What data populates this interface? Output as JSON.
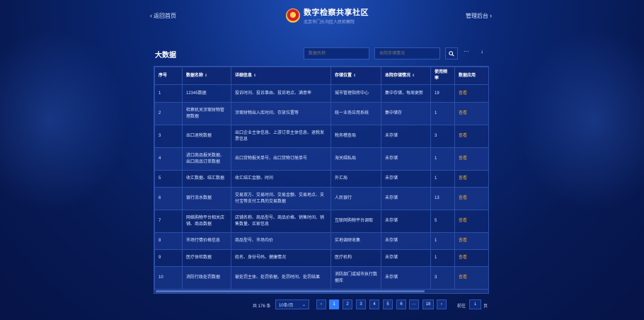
{
  "header": {
    "back_label": "返回首页",
    "title": "数字检察共享社区",
    "subtitle": "北京市门头沟区人民检察院",
    "admin_label": "管理后台"
  },
  "page_title": "大数据",
  "search": {
    "name_placeholder": "数据名称",
    "status_placeholder": "本院存储情况"
  },
  "toolbar": {
    "more_label": "···",
    "download_label": "↓"
  },
  "table": {
    "columns": [
      "序号",
      "数据名称",
      "详细信息",
      "存储位置",
      "本院存储情况",
      "使用频率",
      "数据应用"
    ],
    "rows": [
      {
        "no": "1",
        "name": "12345数据",
        "detail": "投诉时间、投诉事由、投诉地点、满意率",
        "location": "城市管理指挥中心",
        "status": "集中存储，每周更新",
        "freq": "19",
        "action": "查看"
      },
      {
        "no": "2",
        "name": "检察机关涉案财物管理数据",
        "detail": "涉案财物出入库时间、存放位置等",
        "location": "统一业务应用系统",
        "status": "集中储存",
        "freq": "1",
        "action": "查看"
      },
      {
        "no": "3",
        "name": "出口退税数据",
        "detail": "出口企业主体信息、上游订单主体信息、退税发票信息",
        "location": "税务稽查局",
        "status": "未存储",
        "freq": "3",
        "action": "查看"
      },
      {
        "no": "4",
        "name": "进口商品报关数据、出口商品订单数据",
        "detail": "出口货物报关单号、出口货物订舱单号",
        "location": "海关缉私局",
        "status": "未存储",
        "freq": "1",
        "action": "查看"
      },
      {
        "no": "5",
        "name": "收汇数据、结汇数据",
        "detail": "收汇结汇金额、时间",
        "location": "外汇局",
        "status": "未存储",
        "freq": "1",
        "action": "查看"
      },
      {
        "no": "6",
        "name": "银行流水数据",
        "detail": "交易双方、交易时间、交易金额、交易地点、支付宝等支付工具的交易数据",
        "location": "人民银行",
        "status": "未存储",
        "freq": "13",
        "action": "查看"
      },
      {
        "no": "7",
        "name": "网络购物平台相关店铺、商品数据",
        "detail": "店铺名称、商品型号、商品价格、销售时间、销售数量、买家信息",
        "location": "互联网购物平台调取",
        "status": "未存储",
        "freq": "5",
        "action": "查看"
      },
      {
        "no": "8",
        "name": "市场行情价格信息",
        "detail": "商品型号、市场均价",
        "location": "实地调研收集",
        "status": "未存储",
        "freq": "1",
        "action": "查看"
      },
      {
        "no": "9",
        "name": "医疗体检数据",
        "detail": "姓名、身份号码、健康情况",
        "location": "医疗机构",
        "status": "未存储",
        "freq": "1",
        "action": "查看"
      },
      {
        "no": "10",
        "name": "消防行政处罚数据",
        "detail": "被处罚主体、处罚依据、处罚时间、处罚结果",
        "location": "消防部门或城市执行数据库",
        "status": "未存储",
        "freq": "3",
        "action": "查看"
      }
    ]
  },
  "pagination": {
    "total_label": "共 176 条",
    "page_size_label": "10条/页",
    "prev": "‹",
    "pages": [
      "1",
      "2",
      "3",
      "4",
      "5",
      "6",
      "···",
      "18"
    ],
    "next": "›",
    "current": "1",
    "goto_label": "前往",
    "goto_value": "1",
    "goto_unit": "页"
  },
  "colors": {
    "accent": "#2f7dff",
    "action": "#e6a23c",
    "bg": "#0b2a7a"
  }
}
